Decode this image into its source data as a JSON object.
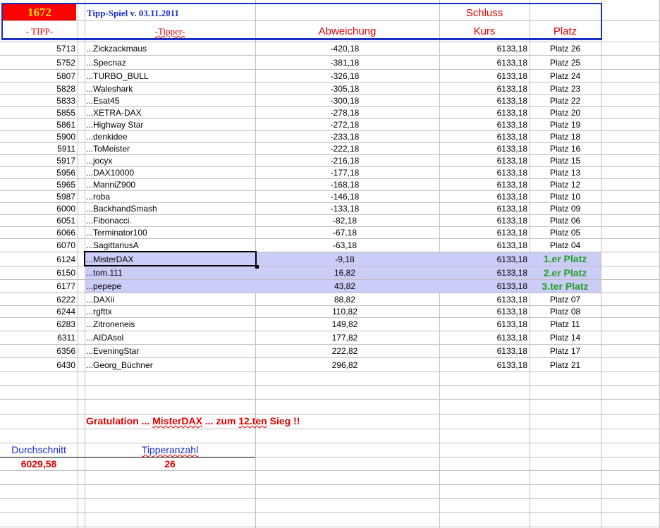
{
  "header": {
    "count": "1672",
    "title": "Tipp-Spiel v. 03.11.2011",
    "col_tipp": "- TIPP-",
    "col_tipper": "-Tipper-",
    "col_abweichung": "Abweichung",
    "col_schluss": "Schluss",
    "col_kurs": "Kurs",
    "col_platz": "Platz"
  },
  "rows": [
    {
      "tipp": "5713",
      "name": "...Zickzackmaus",
      "abw": "-420,18",
      "kurs": "6133,18",
      "platz": "Platz 26"
    },
    {
      "tipp": "5752",
      "name": "...Specnaz",
      "abw": "-381,18",
      "kurs": "6133,18",
      "platz": "Platz 25"
    },
    {
      "tipp": "5807",
      "name": "...TURBO_BULL",
      "abw": "-326,18",
      "kurs": "6133,18",
      "platz": "Platz 24"
    },
    {
      "tipp": "5828",
      "name": "...Waleshark",
      "abw": "-305,18",
      "kurs": "6133,18",
      "platz": "Platz 23"
    },
    {
      "tipp": "5833",
      "name": "...Esat45",
      "abw": "-300,18",
      "kurs": "6133,18",
      "platz": "Platz 22"
    },
    {
      "tipp": "5855",
      "name": "...XETRA-DAX",
      "abw": "-278,18",
      "kurs": "6133,18",
      "platz": "Platz 20"
    },
    {
      "tipp": "5861",
      "name": "...Highway Star",
      "abw": "-272,18",
      "kurs": "6133,18",
      "platz": "Platz 19"
    },
    {
      "tipp": "5900",
      "name": "...denkidee",
      "abw": "-233,18",
      "kurs": "6133,18",
      "platz": "Platz 18"
    },
    {
      "tipp": "5911",
      "name": "...ToMeister",
      "abw": "-222,18",
      "kurs": "6133,18",
      "platz": "Platz 16"
    },
    {
      "tipp": "5917",
      "name": "...jocyx",
      "abw": "-216,18",
      "kurs": "6133,18",
      "platz": "Platz 15"
    },
    {
      "tipp": "5956",
      "name": "...DAX10000",
      "abw": "-177,18",
      "kurs": "6133,18",
      "platz": "Platz 13"
    },
    {
      "tipp": "5965",
      "name": "...ManniZ900",
      "abw": "-168,18",
      "kurs": "6133,18",
      "platz": "Platz 12"
    },
    {
      "tipp": "5987",
      "name": "...roba",
      "abw": "-146,18",
      "kurs": "6133,18",
      "platz": "Platz 10"
    },
    {
      "tipp": "6000",
      "name": "...BackhandSmash",
      "abw": "-133,18",
      "kurs": "6133,18",
      "platz": "Platz 09"
    },
    {
      "tipp": "6051",
      "name": "...Fibonacci.",
      "abw": "-82,18",
      "kurs": "6133,18",
      "platz": "Platz 06"
    },
    {
      "tipp": "6066",
      "name": "...Terminator100",
      "abw": "-67,18",
      "kurs": "6133,18",
      "platz": "Platz 05"
    },
    {
      "tipp": "6070",
      "name": "...SagittariusA",
      "abw": "-63,18",
      "kurs": "6133,18",
      "platz": "Platz 04"
    },
    {
      "tipp": "6124",
      "name": "...MisterDAX",
      "abw": "-9,18",
      "kurs": "6133,18",
      "platz": "1.er Platz",
      "win": true
    },
    {
      "tipp": "6150",
      "name": "...tom.111",
      "abw": "16,82",
      "kurs": "6133,18",
      "platz": "2.er Platz",
      "win": true
    },
    {
      "tipp": "6177",
      "name": "...pepepe",
      "abw": "43,82",
      "kurs": "6133,18",
      "platz": "3.ter Platz",
      "win": true
    },
    {
      "tipp": "6222",
      "name": "...DAXii",
      "abw": "88,82",
      "kurs": "6133,18",
      "platz": "Platz 07"
    },
    {
      "tipp": "6244",
      "name": "...rgfttx",
      "abw": "110,82",
      "kurs": "6133,18",
      "platz": "Platz 08"
    },
    {
      "tipp": "6283",
      "name": "...Zitroneneis",
      "abw": "149,82",
      "kurs": "6133,18",
      "platz": "Platz 11"
    },
    {
      "tipp": "6311",
      "name": "...AIDAsol",
      "abw": "177,82",
      "kurs": "6133,18",
      "platz": "Platz 14"
    },
    {
      "tipp": "6356",
      "name": "...EveningStar",
      "abw": "222,82",
      "kurs": "6133,18",
      "platz": "Platz 17"
    },
    {
      "tipp": "6430",
      "name": "...Georg_Büchner",
      "abw": "296,82",
      "kurs": "6133,18",
      "platz": "Platz 21"
    }
  ],
  "footer": {
    "congrats_a": "Gratulation ... ",
    "congrats_name": "MisterDAX",
    "congrats_b": " ... zum   ",
    "congrats_num": "12.ten",
    "congrats_c": "   Sieg !!",
    "avg_label": "Durchschnitt",
    "avg_value": "6029,58",
    "count_label": "Tipperanzahl",
    "count_value": "26"
  },
  "colors": {
    "red": "#e00000",
    "blue": "#1a2fc8",
    "green": "#22a022",
    "highlight": "#ccccf8"
  }
}
